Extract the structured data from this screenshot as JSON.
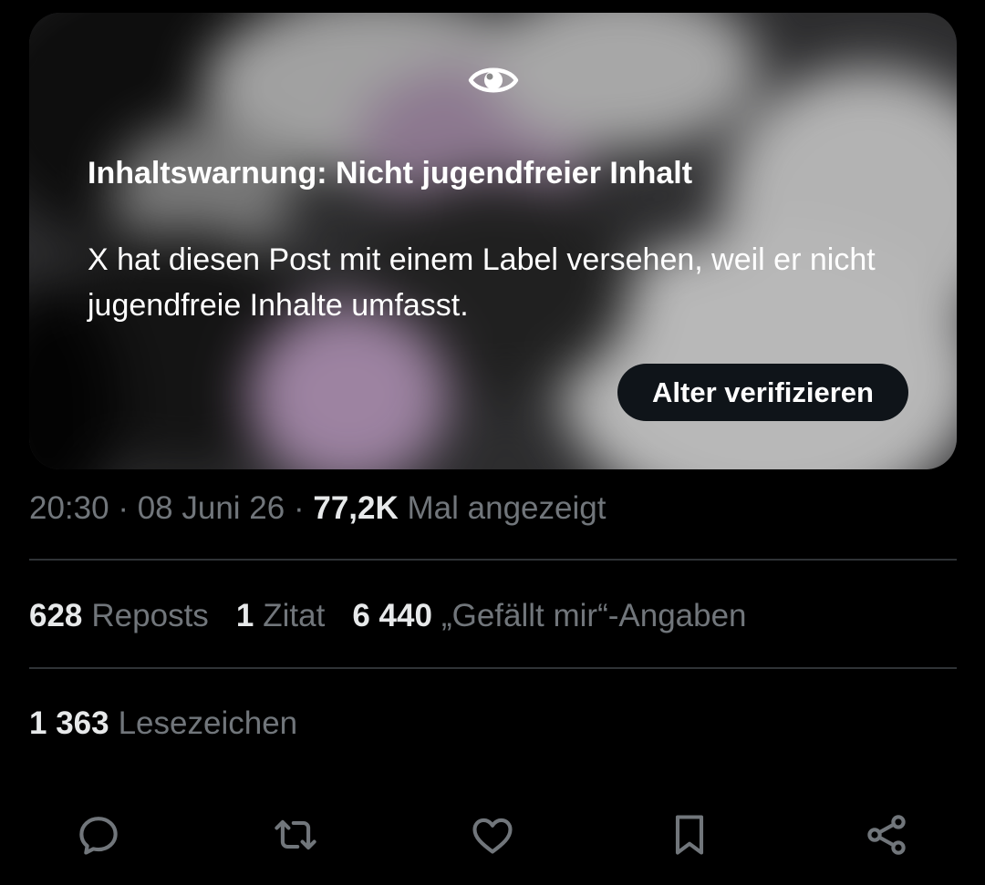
{
  "media": {
    "warning_title": "Inhaltswarnung: Nicht jugendfreier Inhalt",
    "warning_text": "X hat diesen Post mit einem Label versehen, weil er nicht jugendfreie Inhalte umfasst.",
    "verify_button": "Alter verifizieren",
    "icon": "eye-icon"
  },
  "meta": {
    "time": "20:30",
    "separator": "·",
    "date": "08 Juni 26",
    "views_count": "77,2K",
    "views_label": "Mal angezeigt"
  },
  "stats": {
    "reposts_count": "628",
    "reposts_label": "Reposts",
    "quotes_count": "1",
    "quotes_label": "Zitat",
    "likes_count": "6 440",
    "likes_label": "„Gefällt mir“-Angaben",
    "bookmarks_count": "1 363",
    "bookmarks_label": "Lesezeichen"
  },
  "actions": [
    {
      "name": "reply",
      "icon": "reply-icon"
    },
    {
      "name": "repost",
      "icon": "repost-icon"
    },
    {
      "name": "like",
      "icon": "heart-icon"
    },
    {
      "name": "bookmark",
      "icon": "bookmark-icon"
    },
    {
      "name": "share",
      "icon": "share-icon"
    }
  ],
  "colors": {
    "background": "#000000",
    "text_primary": "#e7e9ea",
    "text_secondary": "#71767b",
    "divider": "#2f3336",
    "button_bg": "#0f1419"
  }
}
